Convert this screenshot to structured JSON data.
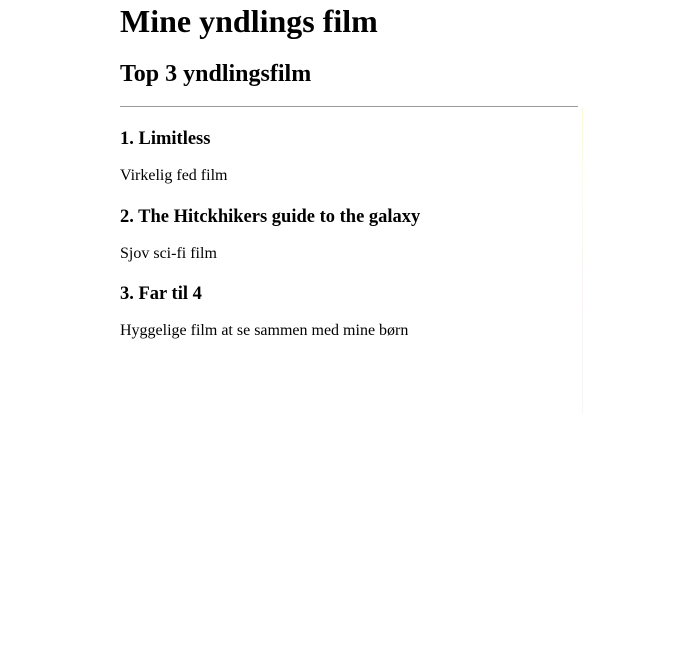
{
  "page": {
    "title": "Mine yndlings film",
    "subtitle": "Top 3 yndlingsfilm"
  },
  "movies": [
    {
      "title": "1. Limitless",
      "description": "Virkelig fed film"
    },
    {
      "title": "2. The Hitckhikers guide to the galaxy",
      "description": "Sjov sci-fi film"
    },
    {
      "title": "3. Far til 4",
      "description": "Hyggelige film at se sammen med mine børn"
    }
  ]
}
